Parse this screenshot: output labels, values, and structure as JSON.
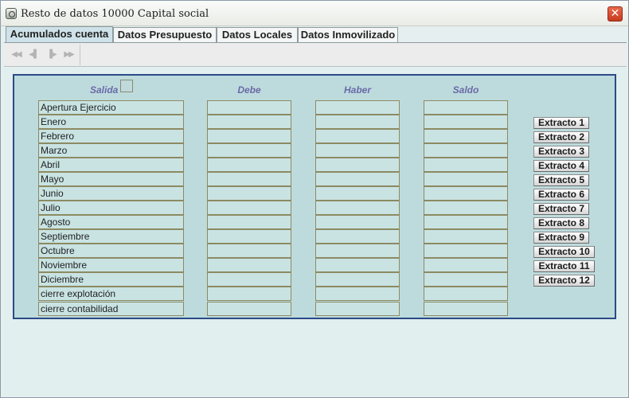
{
  "window": {
    "title": "Resto de datos 10000 Capital social",
    "close_label": "✕"
  },
  "tabs": [
    {
      "label": "Acumulados cuenta",
      "active": true
    },
    {
      "label": "Datos Presupuesto",
      "active": false
    },
    {
      "label": "Datos Locales",
      "active": false
    },
    {
      "label": "Datos Inmovilizado",
      "active": false
    }
  ],
  "toolbar": {
    "buttons": [
      {
        "icon": "first-record-icon",
        "glyph": "◀◀"
      },
      {
        "icon": "previous-record-icon",
        "glyph": "◀▌"
      },
      {
        "icon": "next-record-icon",
        "glyph": "▐▶"
      },
      {
        "icon": "last-record-icon",
        "glyph": "▶▶"
      }
    ]
  },
  "columns": {
    "salida": "Salida",
    "debe": "Debe",
    "haber": "Haber",
    "saldo": "Saldo"
  },
  "rows": [
    {
      "label": "Apertura Ejercicio",
      "debe": "",
      "haber": "",
      "saldo": ""
    },
    {
      "label": "Enero",
      "debe": "",
      "haber": "",
      "saldo": ""
    },
    {
      "label": "Febrero",
      "debe": "",
      "haber": "",
      "saldo": ""
    },
    {
      "label": "Marzo",
      "debe": "",
      "haber": "",
      "saldo": ""
    },
    {
      "label": "Abril",
      "debe": "",
      "haber": "",
      "saldo": ""
    },
    {
      "label": "Mayo",
      "debe": "",
      "haber": "",
      "saldo": ""
    },
    {
      "label": "Junio",
      "debe": "",
      "haber": "",
      "saldo": ""
    },
    {
      "label": "Julio",
      "debe": "",
      "haber": "",
      "saldo": ""
    },
    {
      "label": "Agosto",
      "debe": "",
      "haber": "",
      "saldo": ""
    },
    {
      "label": "Septiembre",
      "debe": "",
      "haber": "",
      "saldo": ""
    },
    {
      "label": "Octubre",
      "debe": "",
      "haber": "",
      "saldo": ""
    },
    {
      "label": "Noviembre",
      "debe": "",
      "haber": "",
      "saldo": ""
    },
    {
      "label": "Diciembre",
      "debe": "",
      "haber": "",
      "saldo": ""
    },
    {
      "label": "cierre explotación",
      "debe": "",
      "haber": "",
      "saldo": ""
    },
    {
      "label": "cierre contabilidad",
      "debe": "",
      "haber": "",
      "saldo": ""
    }
  ],
  "extracto_buttons": [
    "Extracto 1",
    "Extracto 2",
    "Extracto 3",
    "Extracto 4",
    "Extracto 5",
    "Extracto 6",
    "Extracto 7",
    "Extracto 8",
    "Extracto 9",
    "Extracto 10",
    "Extracto 11",
    "Extracto 12"
  ]
}
